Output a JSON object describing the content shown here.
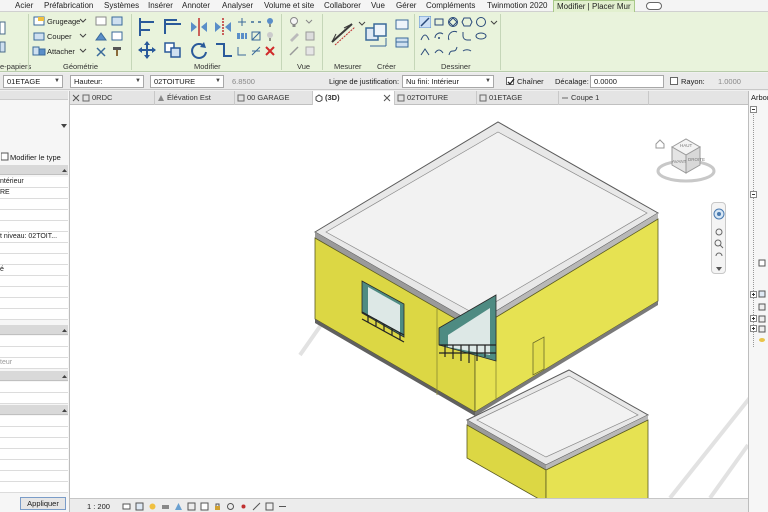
{
  "menu": {
    "tabs": [
      "Acier",
      "Préfabrication",
      "Systèmes",
      "Insérer",
      "Annoter",
      "Analyser",
      "Volume et site",
      "Collaborer",
      "Vue",
      "Gérer",
      "Compléments",
      "Twinmotion 2020",
      "Modifier | Placer Mur"
    ]
  },
  "ribbon": {
    "clipboard_label": "e-papiers",
    "geometry_buttons": [
      "Grugeage",
      "Couper",
      "Attacher"
    ],
    "geometry_label": "Géométrie",
    "modify_label": "Modifier",
    "view_label": "Vue",
    "measure_label": "Mesurer",
    "create_label": "Créer",
    "draw_label": "Dessiner"
  },
  "options": {
    "level": "01ETAGE",
    "height_mode": "Hauteur:",
    "top_level": "02TOITURE",
    "height_value": "6.8500",
    "justification_label": "Ligne de justification:",
    "justification_value": "Nu fini: Intérieur",
    "chain_label": "Chaîner",
    "chain_checked": true,
    "offset_label": "Décalage:",
    "offset_value": "0.0000",
    "radius_label": "Rayon:",
    "radius_checked": false,
    "radius_value": "1.0000"
  },
  "properties": {
    "edit_type": "Modifier le type",
    "row_interior": "ntérieur",
    "row_re": "RE",
    "row_top_level": "t niveau: 02TOIT...",
    "row_mark": "é",
    "row_faded": "teur",
    "apply_button": "Appliquer"
  },
  "view_tabs": [
    "0RDC",
    "Élévation Est",
    "00 GARAGE",
    "(3D)",
    "02TOITURE",
    "01ETAGE",
    "Coupe 1"
  ],
  "active_view_tab": "(3D)",
  "viewcube": {
    "faces": [
      "HAUT",
      "AVANT",
      "DROITE"
    ]
  },
  "browser": {
    "title": "Arbor"
  },
  "status": {
    "scale": "1 : 200"
  },
  "colors": {
    "ribbon_bg": "#e9f3dc",
    "wall_yellow": "#e0dc4c",
    "roof_gray": "#e8e8e8"
  }
}
